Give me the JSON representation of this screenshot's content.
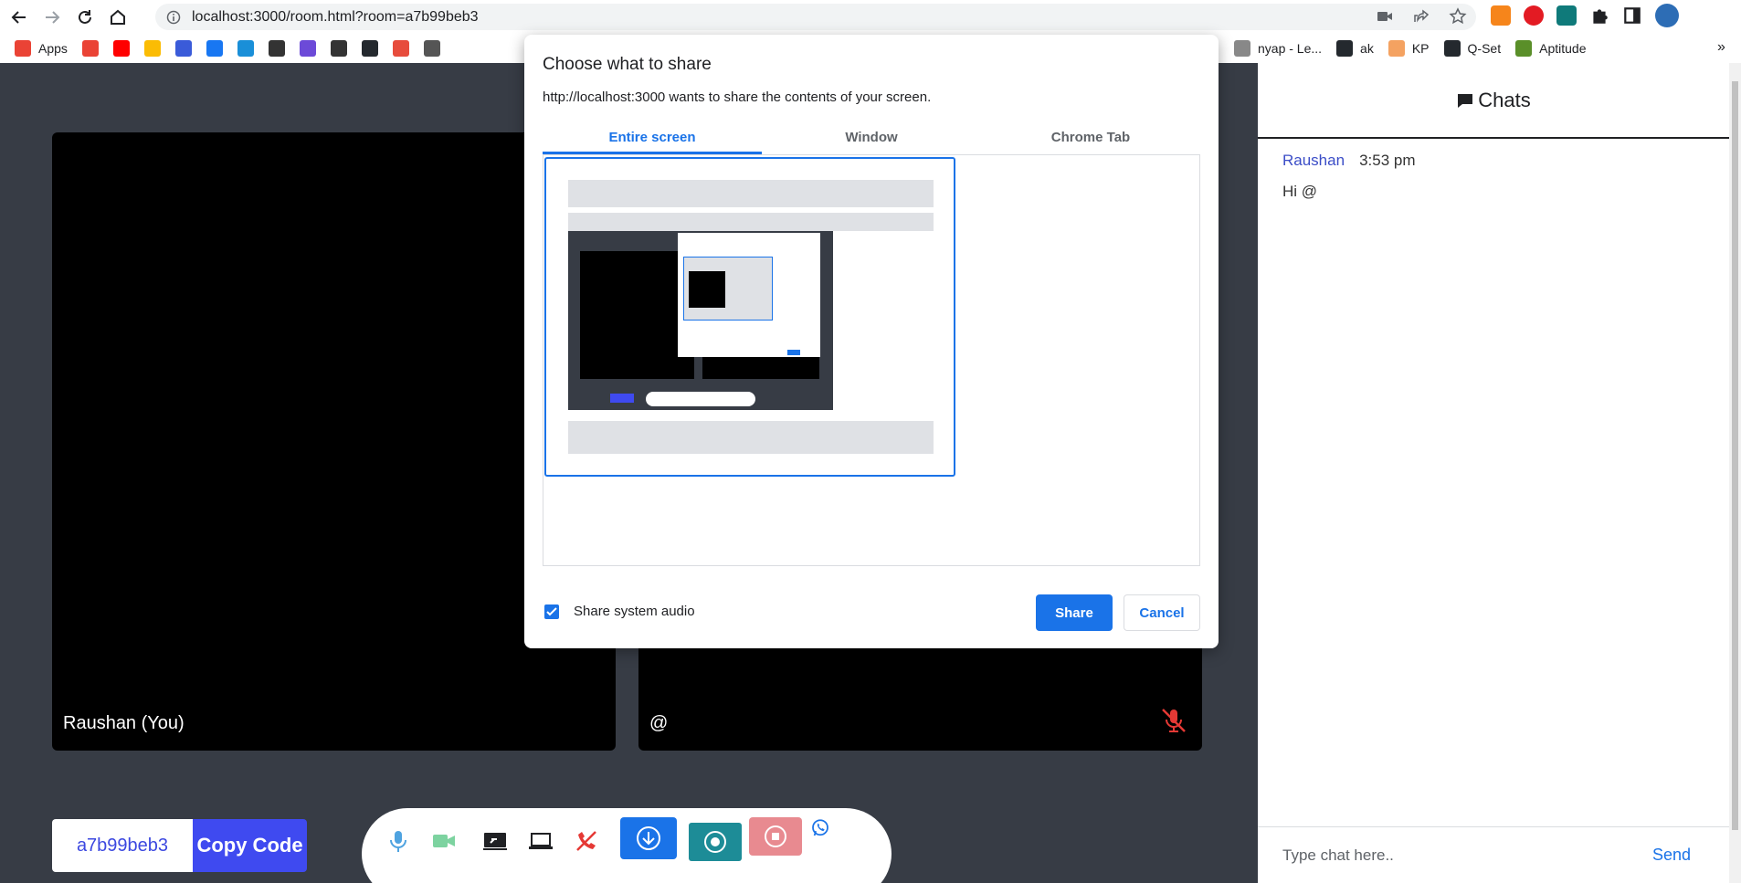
{
  "browser": {
    "url": "localhost:3000/room.html?room=a7b99beb3",
    "bookmarks_left": [
      {
        "label": "Apps",
        "icon": "apps-grid-icon",
        "color": "#ea4335"
      },
      {
        "label": "",
        "icon": "gmail-icon",
        "color": "#ea4335"
      },
      {
        "label": "",
        "icon": "youtube-icon",
        "color": "#ff0000"
      },
      {
        "label": "",
        "icon": "drive-icon",
        "color": "#fbbc04"
      },
      {
        "label": "",
        "icon": "bookmark-icon",
        "color": "#3a5bd9"
      },
      {
        "label": "",
        "icon": "facebook-icon",
        "color": "#1877f2"
      },
      {
        "label": "",
        "icon": "bookmark-icon",
        "color": "#1a8fd8"
      },
      {
        "label": "",
        "icon": "bookmark-icon",
        "color": "#333333"
      },
      {
        "label": "",
        "icon": "bookmark-icon",
        "color": "#6c4ad8"
      },
      {
        "label": "",
        "icon": "cap-icon",
        "color": "#333333"
      },
      {
        "label": "",
        "icon": "github-icon",
        "color": "#24292e"
      },
      {
        "label": "",
        "icon": "bookmark-icon",
        "color": "#e74c3c"
      },
      {
        "label": "",
        "icon": "bookmark-icon",
        "color": "#555555"
      }
    ],
    "bookmarks_right": [
      {
        "label": "nyap - Le...",
        "icon": "bookmark-icon",
        "color": "#888888"
      },
      {
        "label": "ak",
        "icon": "github-icon",
        "color": "#24292e"
      },
      {
        "label": "KP",
        "icon": "bookmark-icon",
        "color": "#f4a261"
      },
      {
        "label": "Q-Set",
        "icon": "github-icon",
        "color": "#24292e"
      },
      {
        "label": "Aptitude",
        "icon": "bookmark-icon",
        "color": "#5a8f29"
      }
    ]
  },
  "meeting": {
    "tiles": [
      {
        "name": "Raushan (You)"
      },
      {
        "name": "@"
      }
    ],
    "room_code": "a7b99beb3",
    "copy_label": "Copy Code"
  },
  "chat": {
    "title": "Chats",
    "messages": [
      {
        "author": "Raushan",
        "time": "3:53 pm",
        "text": "Hi @"
      }
    ],
    "input_placeholder": "Type chat here..",
    "send_label": "Send"
  },
  "dialog": {
    "title": "Choose what to share",
    "subtitle": "http://localhost:3000 wants to share the contents of your screen.",
    "tabs": [
      "Entire screen",
      "Window",
      "Chrome Tab"
    ],
    "active_tab": "Entire screen",
    "share_audio_label": "Share system audio",
    "share_audio_checked": true,
    "share_label": "Share",
    "cancel_label": "Cancel"
  },
  "colors": {
    "page_bg": "#373c45",
    "accent_blue": "#1a73e8",
    "copy_button": "#3f4af0",
    "record_button": "#1d8c97",
    "stop_button": "#e88a90",
    "mic_off_red": "#e53935"
  }
}
